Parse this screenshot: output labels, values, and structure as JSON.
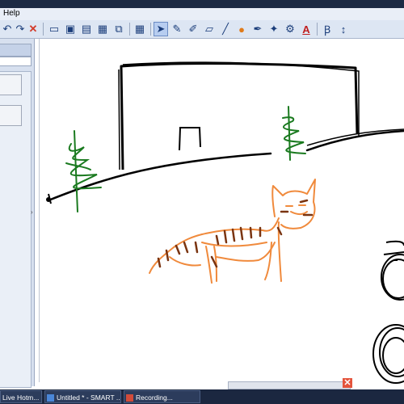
{
  "menu": {
    "help_label": "Help"
  },
  "toolbar": {
    "icons": [
      "undo-icon",
      "redo-icon",
      "delete-icon",
      "screen-shade-icon",
      "display-icon",
      "monitor-icon",
      "capture-icon",
      "record-icon",
      "table-icon",
      "select-arrow-icon",
      "pen-icon",
      "creative-pen-icon",
      "eraser-icon",
      "line-icon",
      "shape-icon",
      "fill-icon",
      "magic-pen-icon",
      "properties-icon",
      "text-icon",
      "font-icon",
      "more-icon"
    ],
    "selected": "select-arrow-icon",
    "text_glyph": "A"
  },
  "taskbar": {
    "items": [
      {
        "label": "Live Hotm..."
      },
      {
        "label": "Untitled * - SMART ..."
      },
      {
        "label": "Recording..."
      }
    ]
  },
  "canvas": {
    "ink_colors": {
      "black": "#000000",
      "green": "#1a7a1f",
      "orange": "#f08a3c",
      "brown": "#7a3410"
    }
  },
  "close_glyph": "✕"
}
